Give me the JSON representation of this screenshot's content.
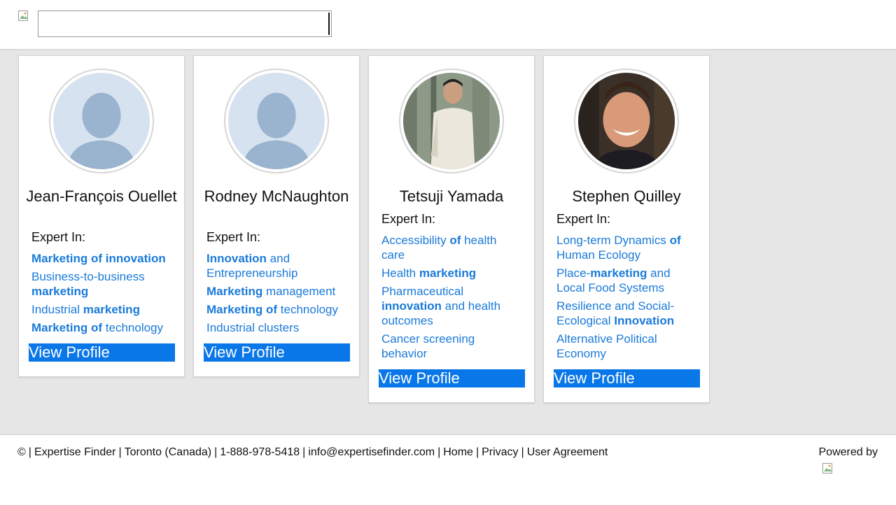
{
  "header": {
    "search": {
      "value": "",
      "placeholder": ""
    }
  },
  "experts": [
    {
      "name": "Jean-François Ouellet",
      "avatar": "placeholder-silhouette",
      "expert_label": "Expert In:",
      "topics": [
        [
          {
            "t": "Marketing of innovation",
            "b": true
          }
        ],
        [
          {
            "t": "Business-to-business ",
            "b": false
          },
          {
            "t": "marketing",
            "b": true
          }
        ],
        [
          {
            "t": "Industrial ",
            "b": false
          },
          {
            "t": "marketing",
            "b": true
          }
        ],
        [
          {
            "t": "Marketing of",
            "b": true
          },
          {
            "t": " technology",
            "b": false
          }
        ]
      ],
      "button": "View Profile"
    },
    {
      "name": "Rodney McNaughton",
      "avatar": "placeholder-silhouette",
      "expert_label": "Expert In:",
      "topics": [
        [
          {
            "t": "Innovation",
            "b": true
          },
          {
            "t": " and Entrepreneurship",
            "b": false
          }
        ],
        [
          {
            "t": "Marketing",
            "b": true
          },
          {
            "t": " management",
            "b": false
          }
        ],
        [
          {
            "t": "Marketing of",
            "b": true
          },
          {
            "t": " technology",
            "b": false
          }
        ],
        [
          {
            "t": "Industrial clusters",
            "b": false
          }
        ]
      ],
      "button": "View Profile"
    },
    {
      "name": "Tetsuji Yamada",
      "avatar": "photo",
      "expert_label": "Expert In:",
      "topics": [
        [
          {
            "t": "Accessibility ",
            "b": false
          },
          {
            "t": "of",
            "b": true
          },
          {
            "t": " health care",
            "b": false
          }
        ],
        [
          {
            "t": "Health ",
            "b": false
          },
          {
            "t": "marketing",
            "b": true
          }
        ],
        [
          {
            "t": "Pharmaceutical ",
            "b": false
          },
          {
            "t": "innovation",
            "b": true
          },
          {
            "t": " and health outcomes",
            "b": false
          }
        ],
        [
          {
            "t": "Cancer screening behavior",
            "b": false
          }
        ]
      ],
      "button": "View Profile"
    },
    {
      "name": "Stephen Quilley",
      "avatar": "photo",
      "expert_label": "Expert In:",
      "topics": [
        [
          {
            "t": "Long-term Dynamics ",
            "b": false
          },
          {
            "t": "of",
            "b": true
          },
          {
            "t": " Human Ecology",
            "b": false
          }
        ],
        [
          {
            "t": "Place-",
            "b": false
          },
          {
            "t": "marketing",
            "b": true
          },
          {
            "t": " and Local Food Systems",
            "b": false
          }
        ],
        [
          {
            "t": "Resilience and Social-Ecological ",
            "b": false
          },
          {
            "t": "Innovation",
            "b": true
          }
        ],
        [
          {
            "t": "Alternative Political Economy",
            "b": false
          }
        ]
      ],
      "button": "View Profile"
    }
  ],
  "footer": {
    "copyright": "©",
    "org": "Expertise Finder",
    "location": "Toronto (Canada)",
    "phone": "1-888-978-5418",
    "email": "info@expertisefinder.com",
    "home": "Home",
    "privacy": "Privacy",
    "agreement": "User Agreement",
    "powered_by": "Powered by"
  },
  "colors": {
    "accent": "#0a77e8",
    "link": "#1a7ad9",
    "background": "#e6e6e6"
  }
}
